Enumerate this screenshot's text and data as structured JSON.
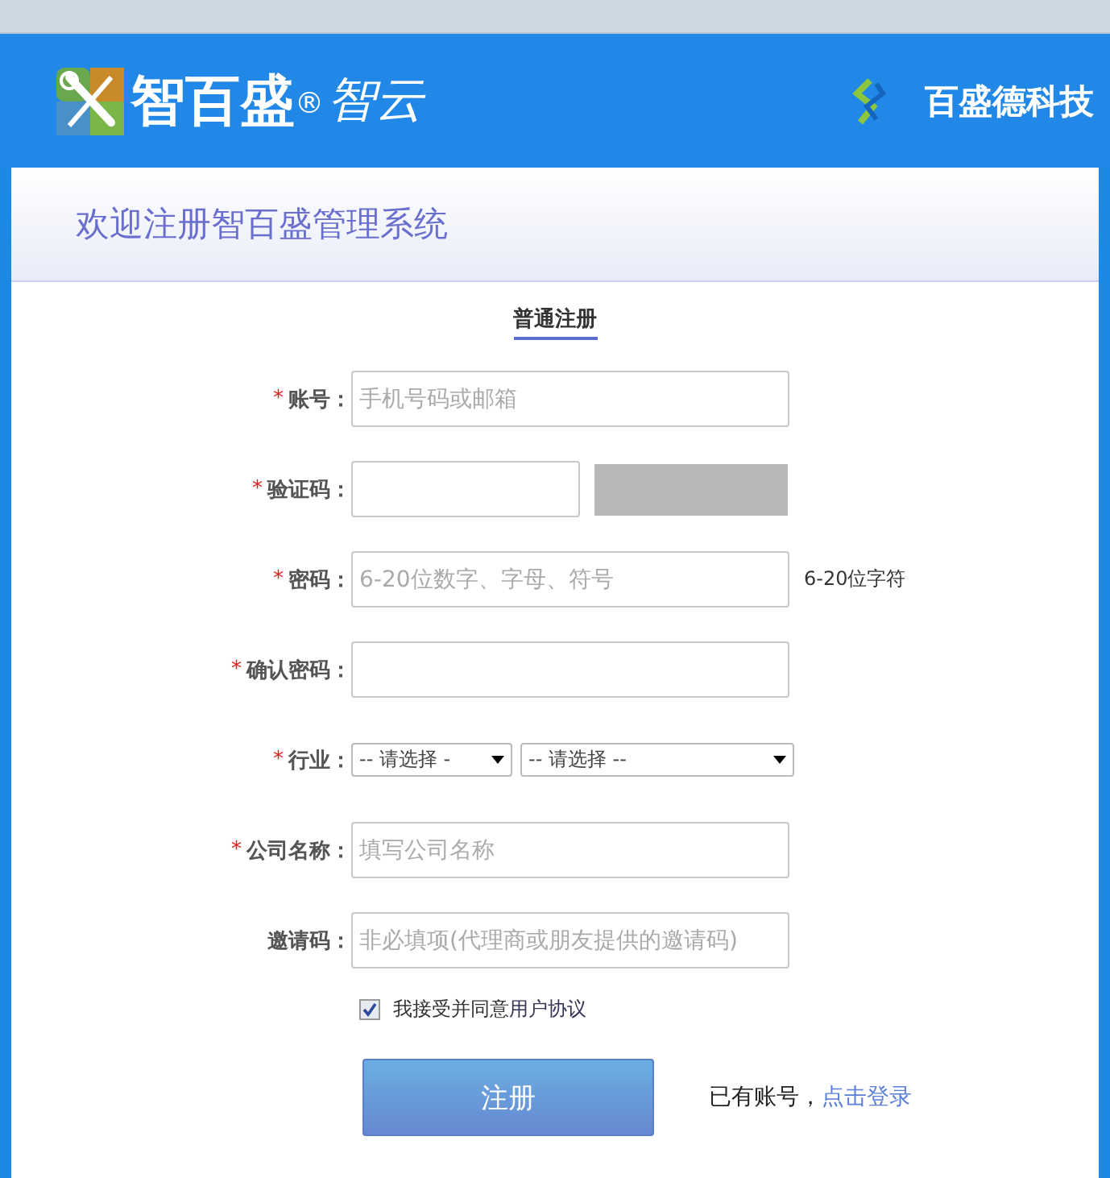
{
  "header": {
    "logo_text": "智百盛",
    "logo_mark": "®",
    "logo_sub": "智云",
    "company": "百盛德科技"
  },
  "title": "欢迎注册智百盛管理系统",
  "tabs": [
    {
      "label": "普通注册",
      "selected": true
    }
  ],
  "required_mark": "*",
  "fields": [
    {
      "kind": "input",
      "label": "账号：",
      "required": true,
      "placeholder": "手机号码或邮箱"
    },
    {
      "kind": "captcha",
      "label": "验证码：",
      "required": true
    },
    {
      "kind": "input",
      "label": "密码：",
      "required": true,
      "placeholder": "6-20位数字、字母、符号",
      "hint": "6-20位字符"
    },
    {
      "kind": "input",
      "label": "确认密码：",
      "required": true
    },
    {
      "kind": "selects",
      "label": "行业：",
      "required": true,
      "options": [
        "-- 请选择 -",
        "-- 请选择 --"
      ]
    },
    {
      "kind": "input",
      "label": "公司名称：",
      "required": true,
      "placeholder": "填写公司名称"
    },
    {
      "kind": "input",
      "label": "邀请码：",
      "required": false,
      "placeholder": "非必填项(代理商或朋友提供的邀请码)"
    }
  ],
  "agreement": {
    "checked": true,
    "text": "我接受并同意",
    "link": "用户协议"
  },
  "submit": "注册",
  "login_prompt": {
    "text": "已有账号，",
    "link": "点击登录"
  }
}
